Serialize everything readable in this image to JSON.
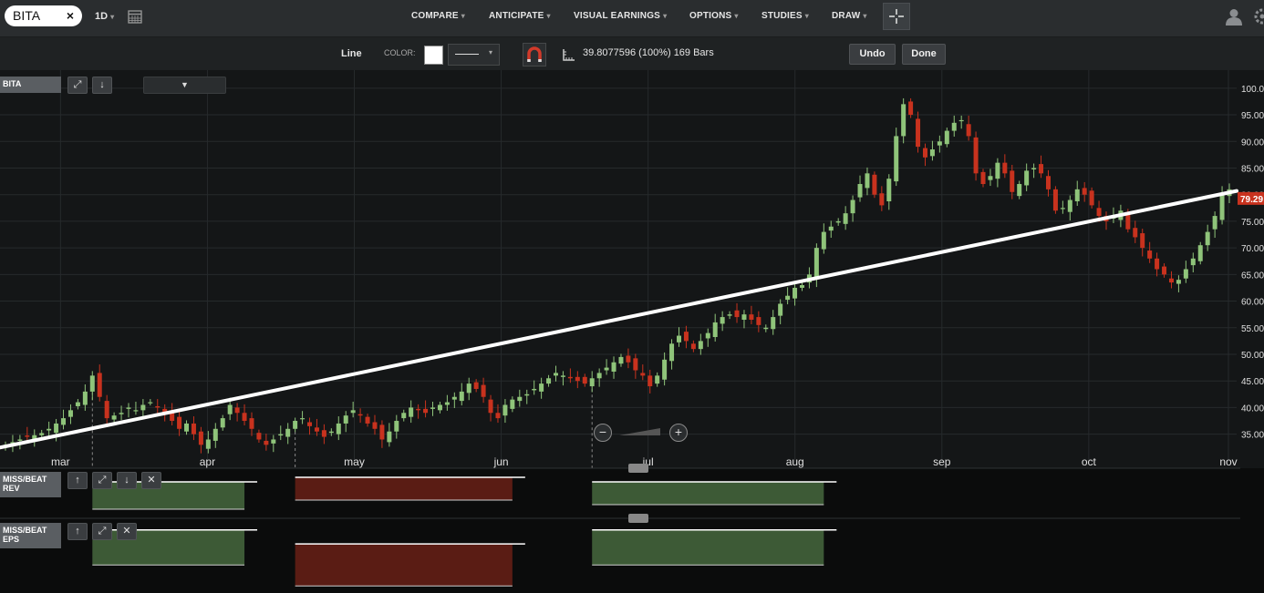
{
  "toolbar": {
    "symbol": "BITA",
    "clear_label": "×",
    "period": "1D",
    "menu": [
      "COMPARE",
      "ANTICIPATE",
      "VISUAL EARNINGS",
      "OPTIONS",
      "STUDIES",
      "DRAW"
    ]
  },
  "drawbar": {
    "tool_label": "Line",
    "color_label": "COLOR:",
    "measure_text": "39.8077596 (100%) 169 Bars",
    "undo_label": "Undo",
    "done_label": "Done",
    "line_color": "#ffffff"
  },
  "panels": {
    "main_label": "BITA",
    "rev_label_1": "MISS/BEAT",
    "rev_label_2": "REV",
    "eps_label_1": "MISS/BEAT",
    "eps_label_2": "EPS"
  },
  "colors": {
    "up": "#8fc47a",
    "down": "#c8321e",
    "trendline": "#ffffff",
    "price_tag": "#c8321e",
    "beat": "#3d5a36",
    "miss": "#5a1c14"
  },
  "chart_data": {
    "type": "candlestick",
    "symbol": "BITA",
    "ylim": [
      31,
      101
    ],
    "y_ticks": [
      "100.00",
      "95.00",
      "90.00",
      "85.00",
      "80.00",
      "75.00",
      "70.00",
      "65.00",
      "60.00",
      "55.00",
      "50.00",
      "45.00",
      "40.00",
      "35.00"
    ],
    "y_tick_values": [
      100,
      95,
      90,
      85,
      80,
      75,
      70,
      65,
      60,
      55,
      50,
      45,
      40,
      35
    ],
    "x_tick_labels": [
      "mar",
      "apr",
      "may",
      "jun",
      "jul",
      "aug",
      "sep",
      "oct",
      "nov"
    ],
    "last_price": "79.29",
    "last_price_value": 79.29,
    "bars": 169,
    "trendline": {
      "start_value": 32.5,
      "end_value": 80.7
    },
    "closes": [
      33,
      33.5,
      34,
      34.5,
      34.8,
      35.2,
      36,
      37,
      38,
      39.5,
      41,
      43,
      46,
      42,
      38,
      38.5,
      39,
      40,
      39.5,
      40.5,
      41,
      40,
      39,
      37.5,
      36,
      37,
      35,
      33,
      34,
      36,
      38,
      40.5,
      39,
      37.5,
      36,
      34,
      33,
      34,
      35,
      36,
      37.5,
      38,
      36.5,
      35.5,
      34.5,
      35.5,
      37,
      38.5,
      39.5,
      38.5,
      37,
      36,
      34,
      35.5,
      37.5,
      39,
      40,
      39.5,
      39,
      40,
      40.5,
      41,
      42,
      43,
      44.5,
      43.5,
      42,
      39,
      38,
      40.5,
      41.5,
      42,
      42.5,
      43.5,
      44.5,
      45.5,
      46.5,
      46,
      45.5,
      45,
      44.5,
      45.5,
      46.5,
      47.5,
      48.5,
      49.5,
      48.5,
      47,
      46,
      44,
      46,
      49,
      52,
      53.5,
      52.5,
      51,
      52.5,
      54,
      56,
      57,
      57.5,
      57,
      57.5,
      56.5,
      55.5,
      55,
      57,
      59.5,
      61,
      62.5,
      63,
      65,
      70,
      73,
      74,
      75,
      76.5,
      79,
      82,
      84,
      80,
      78,
      83,
      91,
      97,
      95,
      89,
      87,
      88.5,
      90,
      92,
      93.5,
      94,
      91,
      84,
      82,
      83.5,
      86,
      84,
      80.5,
      82,
      84.5,
      85,
      84,
      81,
      77,
      77.5,
      79,
      81,
      80,
      78,
      76,
      75,
      76,
      77,
      73.5,
      72,
      70,
      68,
      66,
      65,
      63.5,
      64,
      66,
      68,
      70.5,
      73,
      76,
      80,
      81
    ],
    "rev_bars": [
      {
        "start_index": 12,
        "end_index": 33,
        "result": "beat",
        "estimate": 0.8,
        "actual": 0.2
      },
      {
        "start_index": 40,
        "end_index": 70,
        "result": "miss",
        "estimate": 0.9,
        "actual": 0.4
      },
      {
        "start_index": 81,
        "end_index": 113,
        "result": "beat",
        "estimate": 0.8,
        "actual": 0.3
      }
    ],
    "eps_bars": [
      {
        "start_index": 12,
        "end_index": 33,
        "result": "beat",
        "estimate": 0.9,
        "actual": 0.4
      },
      {
        "start_index": 40,
        "end_index": 70,
        "result": "miss",
        "estimate": 0.7,
        "actual": 0.1
      },
      {
        "start_index": 81,
        "end_index": 113,
        "result": "beat",
        "estimate": 0.9,
        "actual": 0.4
      }
    ]
  }
}
